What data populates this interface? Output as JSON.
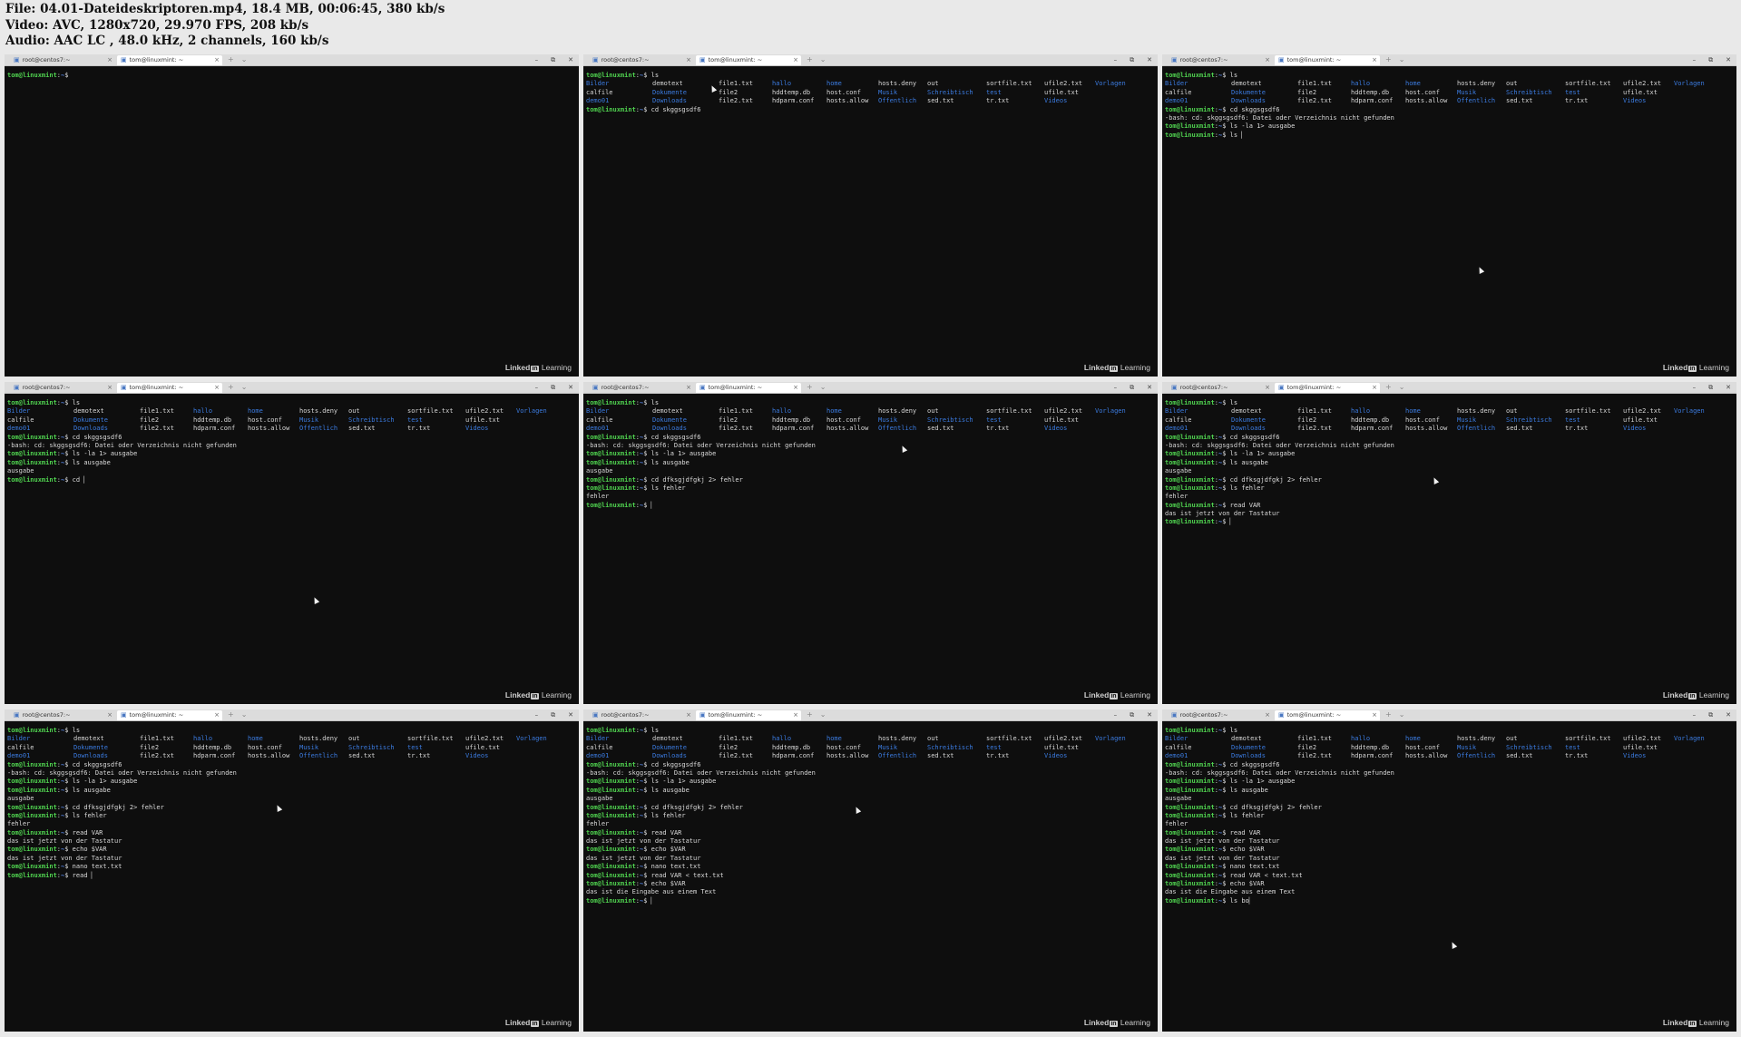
{
  "info": {
    "file_line": "File: 04.01-Dateideskriptoren.mp4, 18.4 MB, 00:06:45, 380 kb/s",
    "video_line": "Video: AVC, 1280x720, 29.970 FPS, 208 kb/s",
    "audio_line": "Audio: AAC LC , 48.0 kHz, 2 channels, 160 kb/s"
  },
  "window": {
    "tab1_label": "root@centos7:~",
    "tab2_label": "tom@linuxmint: ~",
    "tab_icon": "terminal-icon",
    "tab_close_glyph": "×",
    "new_tab_glyph": "+",
    "tab_menu_glyph": "⌄",
    "minimize_glyph": "–",
    "restore_glyph": "⧉",
    "close_glyph": "✕",
    "brand_pre": "Linked",
    "brand_in": "in",
    "brand_post": "Learning"
  },
  "ls_output": [
    [
      {
        "t": "Bilder",
        "c": "dir"
      },
      {
        "t": "demotext",
        "c": "file"
      },
      {
        "t": "file1.txt",
        "c": "file"
      },
      {
        "t": "hallo",
        "c": "dir"
      },
      {
        "t": "home",
        "c": "dir"
      },
      {
        "t": "hosts.deny",
        "c": "file"
      },
      {
        "t": "out",
        "c": "file"
      },
      {
        "t": "sortfile.txt",
        "c": "file"
      },
      {
        "t": "ufile2.txt",
        "c": "file"
      },
      {
        "t": "Vorlagen",
        "c": "dir"
      }
    ],
    [
      {
        "t": "calfile",
        "c": "file"
      },
      {
        "t": "Dokumente",
        "c": "dir"
      },
      {
        "t": "file2",
        "c": "file"
      },
      {
        "t": "hddtemp.db",
        "c": "file"
      },
      {
        "t": "host.conf",
        "c": "file"
      },
      {
        "t": "Musik",
        "c": "dir"
      },
      {
        "t": "Schreibtisch",
        "c": "dir"
      },
      {
        "t": "test",
        "c": "dir"
      },
      {
        "t": "ufile.txt",
        "c": "file"
      },
      {
        "t": "",
        "c": "file"
      }
    ],
    [
      {
        "t": "demo01",
        "c": "dir"
      },
      {
        "t": "Downloads",
        "c": "dir"
      },
      {
        "t": "file2.txt",
        "c": "file"
      },
      {
        "t": "hdparm.conf",
        "c": "file"
      },
      {
        "t": "hosts.allow",
        "c": "file"
      },
      {
        "t": "Öffentlich",
        "c": "dir"
      },
      {
        "t": "sed.txt",
        "c": "file"
      },
      {
        "t": "tr.txt",
        "c": "file"
      },
      {
        "t": "Videos",
        "c": "dir"
      },
      {
        "t": "",
        "c": "file"
      }
    ]
  ],
  "prompt": {
    "user_host": "tom@linuxmint",
    "separator": ":",
    "path": "~",
    "symbol": "$ "
  },
  "cursor_glyph": "▏",
  "frames": [
    {
      "lines": [
        {
          "k": "prompt",
          "t": "",
          "cursor": false
        }
      ]
    },
    {
      "lines": [
        {
          "k": "prompt",
          "t": "ls"
        },
        {
          "k": "ls"
        },
        {
          "k": "prompt",
          "t": "cd skggsgsdf6"
        }
      ]
    },
    {
      "lines": [
        {
          "k": "prompt",
          "t": "ls"
        },
        {
          "k": "ls"
        },
        {
          "k": "prompt",
          "t": "cd skggsgsdf6"
        },
        {
          "k": "out",
          "t": "-bash: cd: skggsgsdf6: Datei oder Verzeichnis nicht gefunden"
        },
        {
          "k": "prompt",
          "t": "ls -la 1> ausgabe"
        },
        {
          "k": "prompt",
          "t": "ls ",
          "cursor": true
        }
      ]
    },
    {
      "lines": [
        {
          "k": "prompt",
          "t": "ls"
        },
        {
          "k": "ls"
        },
        {
          "k": "prompt",
          "t": "cd skggsgsdf6"
        },
        {
          "k": "out",
          "t": "-bash: cd: skggsgsdf6: Datei oder Verzeichnis nicht gefunden"
        },
        {
          "k": "prompt",
          "t": "ls -la 1> ausgabe"
        },
        {
          "k": "prompt",
          "t": "ls ausgabe"
        },
        {
          "k": "out",
          "t": "ausgabe"
        },
        {
          "k": "prompt",
          "t": "cd ",
          "cursor": true
        }
      ]
    },
    {
      "lines": [
        {
          "k": "prompt",
          "t": "ls"
        },
        {
          "k": "ls"
        },
        {
          "k": "prompt",
          "t": "cd skggsgsdf6"
        },
        {
          "k": "out",
          "t": "-bash: cd: skggsgsdf6: Datei oder Verzeichnis nicht gefunden"
        },
        {
          "k": "prompt",
          "t": "ls -la 1> ausgabe"
        },
        {
          "k": "prompt",
          "t": "ls ausgabe"
        },
        {
          "k": "out",
          "t": "ausgabe"
        },
        {
          "k": "prompt",
          "t": "cd dfksgjdfgkj 2> fehler"
        },
        {
          "k": "prompt",
          "t": "ls fehler"
        },
        {
          "k": "out",
          "t": "fehler"
        },
        {
          "k": "prompt",
          "t": "",
          "cursor": true
        }
      ]
    },
    {
      "lines": [
        {
          "k": "prompt",
          "t": "ls"
        },
        {
          "k": "ls"
        },
        {
          "k": "prompt",
          "t": "cd skggsgsdf6"
        },
        {
          "k": "out",
          "t": "-bash: cd: skggsgsdf6: Datei oder Verzeichnis nicht gefunden"
        },
        {
          "k": "prompt",
          "t": "ls -la 1> ausgabe"
        },
        {
          "k": "prompt",
          "t": "ls ausgabe"
        },
        {
          "k": "out",
          "t": "ausgabe"
        },
        {
          "k": "prompt",
          "t": "cd dfksgjdfgkj 2> fehler"
        },
        {
          "k": "prompt",
          "t": "ls fehler"
        },
        {
          "k": "out",
          "t": "fehler"
        },
        {
          "k": "prompt",
          "t": "read VAR"
        },
        {
          "k": "out",
          "t": "das ist jetzt von der Tastatur"
        },
        {
          "k": "prompt",
          "t": "",
          "cursor": true
        }
      ]
    },
    {
      "lines": [
        {
          "k": "prompt",
          "t": "ls"
        },
        {
          "k": "ls"
        },
        {
          "k": "prompt",
          "t": "cd skggsgsdf6"
        },
        {
          "k": "out",
          "t": "-bash: cd: skggsgsdf6: Datei oder Verzeichnis nicht gefunden"
        },
        {
          "k": "prompt",
          "t": "ls -la 1> ausgabe"
        },
        {
          "k": "prompt",
          "t": "ls ausgabe"
        },
        {
          "k": "out",
          "t": "ausgabe"
        },
        {
          "k": "prompt",
          "t": "cd dfksgjdfgkj 2> fehler"
        },
        {
          "k": "prompt",
          "t": "ls fehler"
        },
        {
          "k": "out",
          "t": "fehler"
        },
        {
          "k": "prompt",
          "t": "read VAR"
        },
        {
          "k": "out",
          "t": "das ist jetzt von der Tastatur"
        },
        {
          "k": "prompt",
          "t": "echo $VAR"
        },
        {
          "k": "out",
          "t": "das ist jetzt von der Tastatur"
        },
        {
          "k": "prompt",
          "t": "nano text.txt"
        },
        {
          "k": "prompt",
          "t": "read ",
          "cursor": true
        }
      ]
    },
    {
      "lines": [
        {
          "k": "prompt",
          "t": "ls"
        },
        {
          "k": "ls"
        },
        {
          "k": "prompt",
          "t": "cd skggsgsdf6"
        },
        {
          "k": "out",
          "t": "-bash: cd: skggsgsdf6: Datei oder Verzeichnis nicht gefunden"
        },
        {
          "k": "prompt",
          "t": "ls -la 1> ausgabe"
        },
        {
          "k": "prompt",
          "t": "ls ausgabe"
        },
        {
          "k": "out",
          "t": "ausgabe"
        },
        {
          "k": "prompt",
          "t": "cd dfksgjdfgkj 2> fehler"
        },
        {
          "k": "prompt",
          "t": "ls fehler"
        },
        {
          "k": "out",
          "t": "fehler"
        },
        {
          "k": "prompt",
          "t": "read VAR"
        },
        {
          "k": "out",
          "t": "das ist jetzt von der Tastatur"
        },
        {
          "k": "prompt",
          "t": "echo $VAR"
        },
        {
          "k": "out",
          "t": "das ist jetzt von der Tastatur"
        },
        {
          "k": "prompt",
          "t": "nano text.txt"
        },
        {
          "k": "prompt",
          "t": "read VAR < text.txt"
        },
        {
          "k": "prompt",
          "t": "echo $VAR"
        },
        {
          "k": "out",
          "t": "das ist die Eingabe aus einem Text"
        },
        {
          "k": "prompt",
          "t": "",
          "cursor": true
        }
      ]
    },
    {
      "lines": [
        {
          "k": "prompt",
          "t": "ls"
        },
        {
          "k": "ls"
        },
        {
          "k": "prompt",
          "t": "cd skggsgsdf6"
        },
        {
          "k": "out",
          "t": "-bash: cd: skggsgsdf6: Datei oder Verzeichnis nicht gefunden"
        },
        {
          "k": "prompt",
          "t": "ls -la 1> ausgabe"
        },
        {
          "k": "prompt",
          "t": "ls ausgabe"
        },
        {
          "k": "out",
          "t": "ausgabe"
        },
        {
          "k": "prompt",
          "t": "cd dfksgjdfgkj 2> fehler"
        },
        {
          "k": "prompt",
          "t": "ls fehler"
        },
        {
          "k": "out",
          "t": "fehler"
        },
        {
          "k": "prompt",
          "t": "read VAR"
        },
        {
          "k": "out",
          "t": "das ist jetzt von der Tastatur"
        },
        {
          "k": "prompt",
          "t": "echo $VAR"
        },
        {
          "k": "out",
          "t": "das ist jetzt von der Tastatur"
        },
        {
          "k": "prompt",
          "t": "nano text.txt"
        },
        {
          "k": "prompt",
          "t": "read VAR < text.txt"
        },
        {
          "k": "prompt",
          "t": "echo $VAR"
        },
        {
          "k": "out",
          "t": "das ist die Eingabe aus einem Text"
        },
        {
          "k": "prompt",
          "t": "ls bo",
          "cursor": true
        }
      ]
    }
  ],
  "colors": {
    "terminal_bg": "#0e0e0e",
    "prompt_user": "#4fd14f",
    "prompt_path": "#5a8cf0",
    "directory": "#3b7be0",
    "text": "#d6d6d6"
  }
}
